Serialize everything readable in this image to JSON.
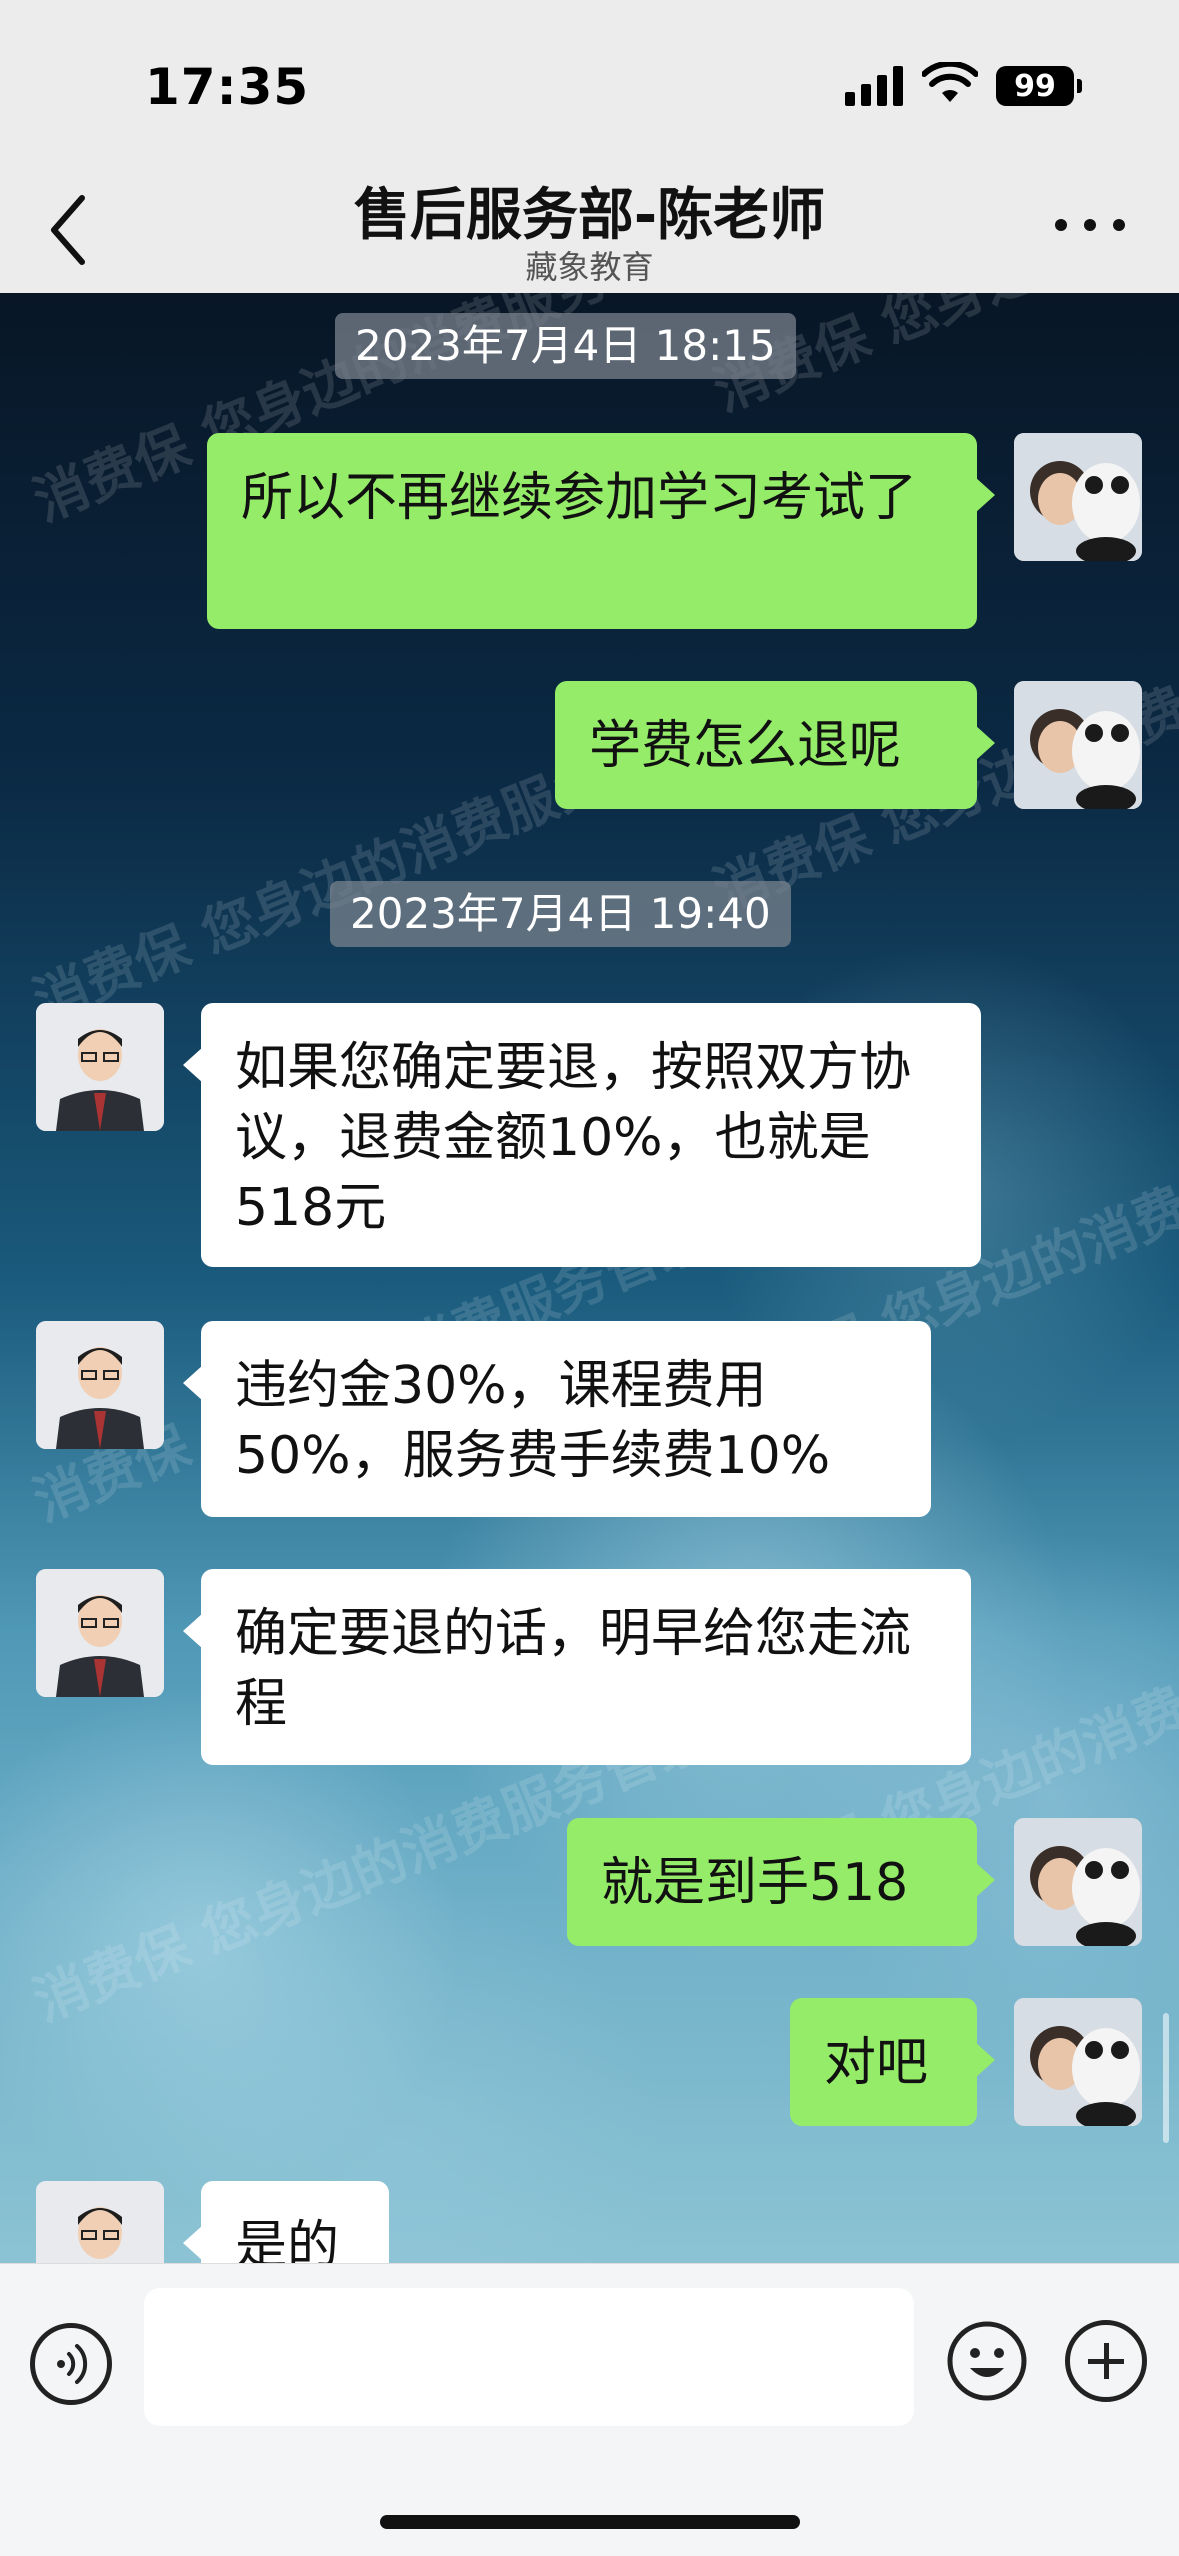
{
  "status_bar": {
    "time": "17:35",
    "battery": "99"
  },
  "header": {
    "title": "售后服务部-陈老师",
    "subtitle": "藏象教育"
  },
  "watermark": "消费保 您身边的消费服务管家",
  "messages": [
    {
      "type": "timestamp",
      "text": "2023年7月4日 18:15"
    },
    {
      "type": "self",
      "text": "所以不再继续参加学习考试了"
    },
    {
      "type": "self",
      "text": "学费怎么退呢"
    },
    {
      "type": "timestamp",
      "text": "2023年7月4日 19:40"
    },
    {
      "type": "agent",
      "text": "如果您确定要退，按照双方协议，退费金额10%，也就是518元"
    },
    {
      "type": "agent",
      "text": "违约金30%，课程费用50%，服务费手续费10%"
    },
    {
      "type": "agent",
      "text": "确定要退的话，明早给您走流程"
    },
    {
      "type": "self",
      "text": "就是到手518"
    },
    {
      "type": "self",
      "text": "对吧"
    },
    {
      "type": "agent",
      "text": "是的"
    }
  ]
}
